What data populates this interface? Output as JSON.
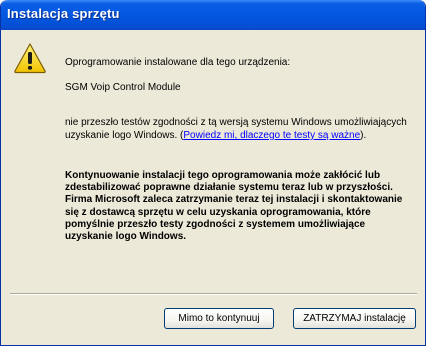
{
  "window": {
    "title": "Instalacja sprzętu"
  },
  "message": {
    "intro": "Oprogramowanie instalowane dla tego urządzenia:",
    "device_name": "SGM Voip Control Module",
    "compat_text": "nie przeszło testów zgodności z tą wersją systemu Windows umożliwiających uzyskanie logo Windows. (",
    "compat_link": "Powiedz mi, dlaczego te testy są ważne",
    "compat_end": ").",
    "warning": "Kontynuowanie instalacji tego oprogramowania może zakłócić lub zdestabilizować poprawne działanie systemu teraz lub w przyszłości. Firma Microsoft zaleca zatrzymanie teraz tej instalacji i skontaktowanie się z dostawcą sprzętu w celu uzyskania oprogramowania, które pomyślnie przeszło testy zgodności z systemem umożliwiające uzyskanie logo Windows."
  },
  "buttons": {
    "continue_label": "Mimo to kontynuuj",
    "stop_label": "ZATRZYMAJ instalację"
  },
  "icons": {
    "warning": "warning-icon"
  },
  "colors": {
    "titlebar": "#0356e0",
    "link": "#0000ff",
    "dialog_bg": "#ece9d8"
  }
}
